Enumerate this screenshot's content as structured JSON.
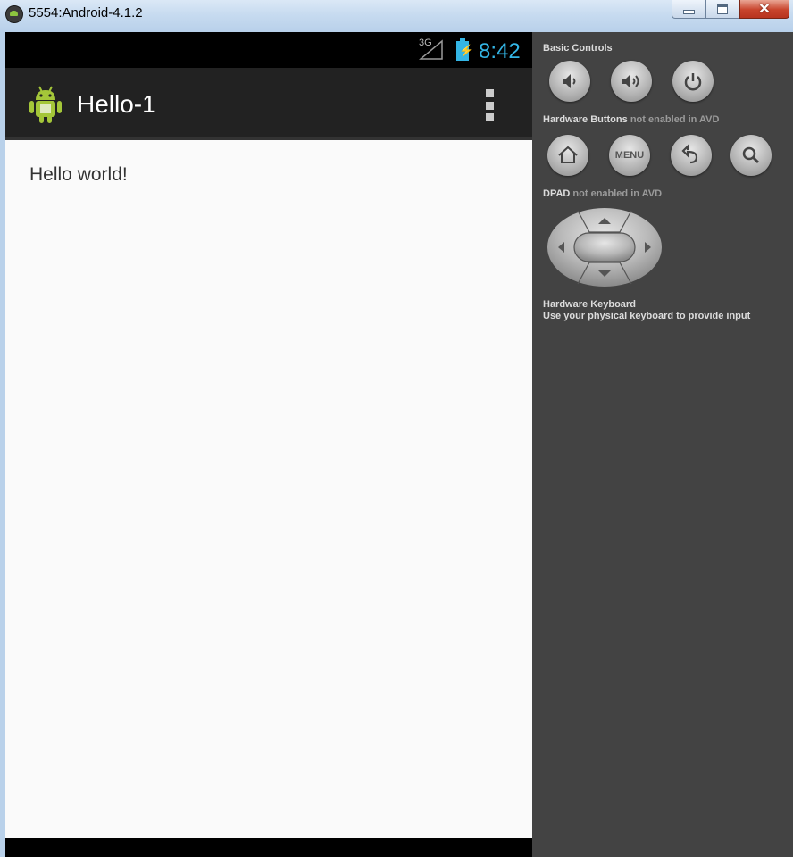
{
  "window": {
    "title": "5554:Android-4.1.2"
  },
  "status_bar": {
    "network": "3G",
    "time": "8:42",
    "battery_color": "#33b5e5"
  },
  "action_bar": {
    "title": "Hello-1",
    "app_icon": "android-icon",
    "overflow_icon": "overflow-menu-icon"
  },
  "content": {
    "text": "Hello world!"
  },
  "panel": {
    "basic_controls_label": "Basic Controls",
    "basic_controls": [
      {
        "icon": "volume-down-icon"
      },
      {
        "icon": "volume-up-icon"
      },
      {
        "icon": "power-icon"
      }
    ],
    "hardware_buttons_label": "Hardware Buttons",
    "hardware_buttons_note": "not enabled in AVD",
    "hardware_buttons": [
      {
        "icon": "home-icon"
      },
      {
        "label": "MENU"
      },
      {
        "icon": "back-icon"
      },
      {
        "icon": "search-icon"
      }
    ],
    "dpad_label": "DPAD",
    "dpad_note": "not enabled in AVD",
    "keyboard_label": "Hardware Keyboard",
    "keyboard_note": "Use your physical keyboard to provide input"
  }
}
